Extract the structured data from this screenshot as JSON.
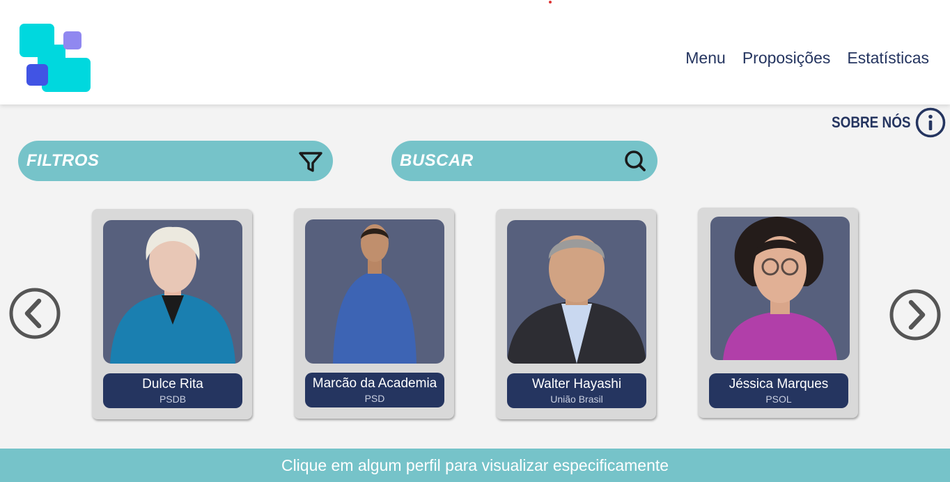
{
  "header": {
    "nav": [
      {
        "label": "Menu"
      },
      {
        "label": "Proposições"
      },
      {
        "label": "Estatísticas"
      }
    ]
  },
  "sobre": {
    "label": "SOBRE NÓS",
    "icon": "info-icon"
  },
  "filtros": {
    "label": "FILTROS",
    "icon": "filter-icon"
  },
  "buscar": {
    "label": "BUSCAR",
    "icon": "search-icon"
  },
  "carousel": {
    "prev_icon": "chevron-left-icon",
    "next_icon": "chevron-right-icon",
    "cards": [
      {
        "name": "Dulce Rita",
        "party": "PSDB"
      },
      {
        "name": "Marcão da Academia",
        "party": "PSD"
      },
      {
        "name": "Walter Hayashi",
        "party": "União Brasil"
      },
      {
        "name": "Jéssica Marques",
        "party": "PSOL"
      }
    ]
  },
  "footer": {
    "text": "Clique em algum perfil para visualizar especificamente"
  },
  "colors": {
    "navy": "#253560",
    "teal": "#76c3c9",
    "logo_cyan": "#00d8de",
    "logo_blue": "#4154e4",
    "logo_lilac": "#9088f0",
    "photo_bg": "#57607d"
  }
}
